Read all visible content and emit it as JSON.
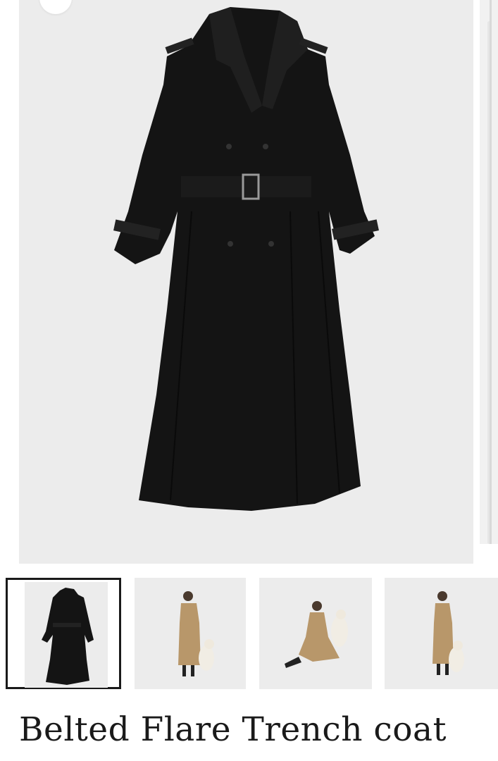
{
  "product": {
    "title": "Belted Flare Trench coat"
  },
  "gallery": {
    "selected_index": 0,
    "thumbnails": [
      {
        "subject": "black-trench-coat-flatlay"
      },
      {
        "subject": "beige-trench-model-with-dog"
      },
      {
        "subject": "beige-trench-model-seated-with-dog"
      },
      {
        "subject": "beige-trench-model-with-dog-side"
      }
    ]
  },
  "colors": {
    "coat": "#141414",
    "beige_coat": "#b8976a",
    "background": "#ececec",
    "selected_border": "#1a1a1a"
  }
}
